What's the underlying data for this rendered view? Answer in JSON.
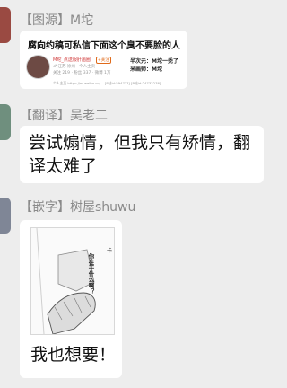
{
  "messages": [
    {
      "sender": "【图源】M坨",
      "card": {
        "title": "腐向约稿可私信下面这个臭不要脸的人",
        "account_name": "M坨_点送服肝画圈",
        "follow_label": "+关注",
        "account_meta": "♂ 江苏·徐州 · 个人主页",
        "account_stats": "关注 219 · 粉丝 337 · 微博 1万",
        "line1": "半次元：M坨一秃了",
        "line2": "米画师：M坨",
        "url_line": "个人主页 https://m.weibo.cn/... [P站id:59473?] [B站id:24732276]"
      }
    },
    {
      "sender": "【翻译】吴老二",
      "text": "尝试煽情，但我只有矫情，翻译太难了"
    },
    {
      "sender": "【嵌字】树屋shuwu",
      "image": {
        "vertical_text": "你在干什么啊？",
        "side_label": "卡"
      },
      "caption": "我也想要！"
    }
  ],
  "colors": {
    "background": "#ededed",
    "bubble": "#ffffff",
    "sender_name": "#8a8a8a",
    "avatar1": "#9a4a42",
    "avatar2": "#6f8f7e",
    "avatar3": "#7f8696"
  }
}
